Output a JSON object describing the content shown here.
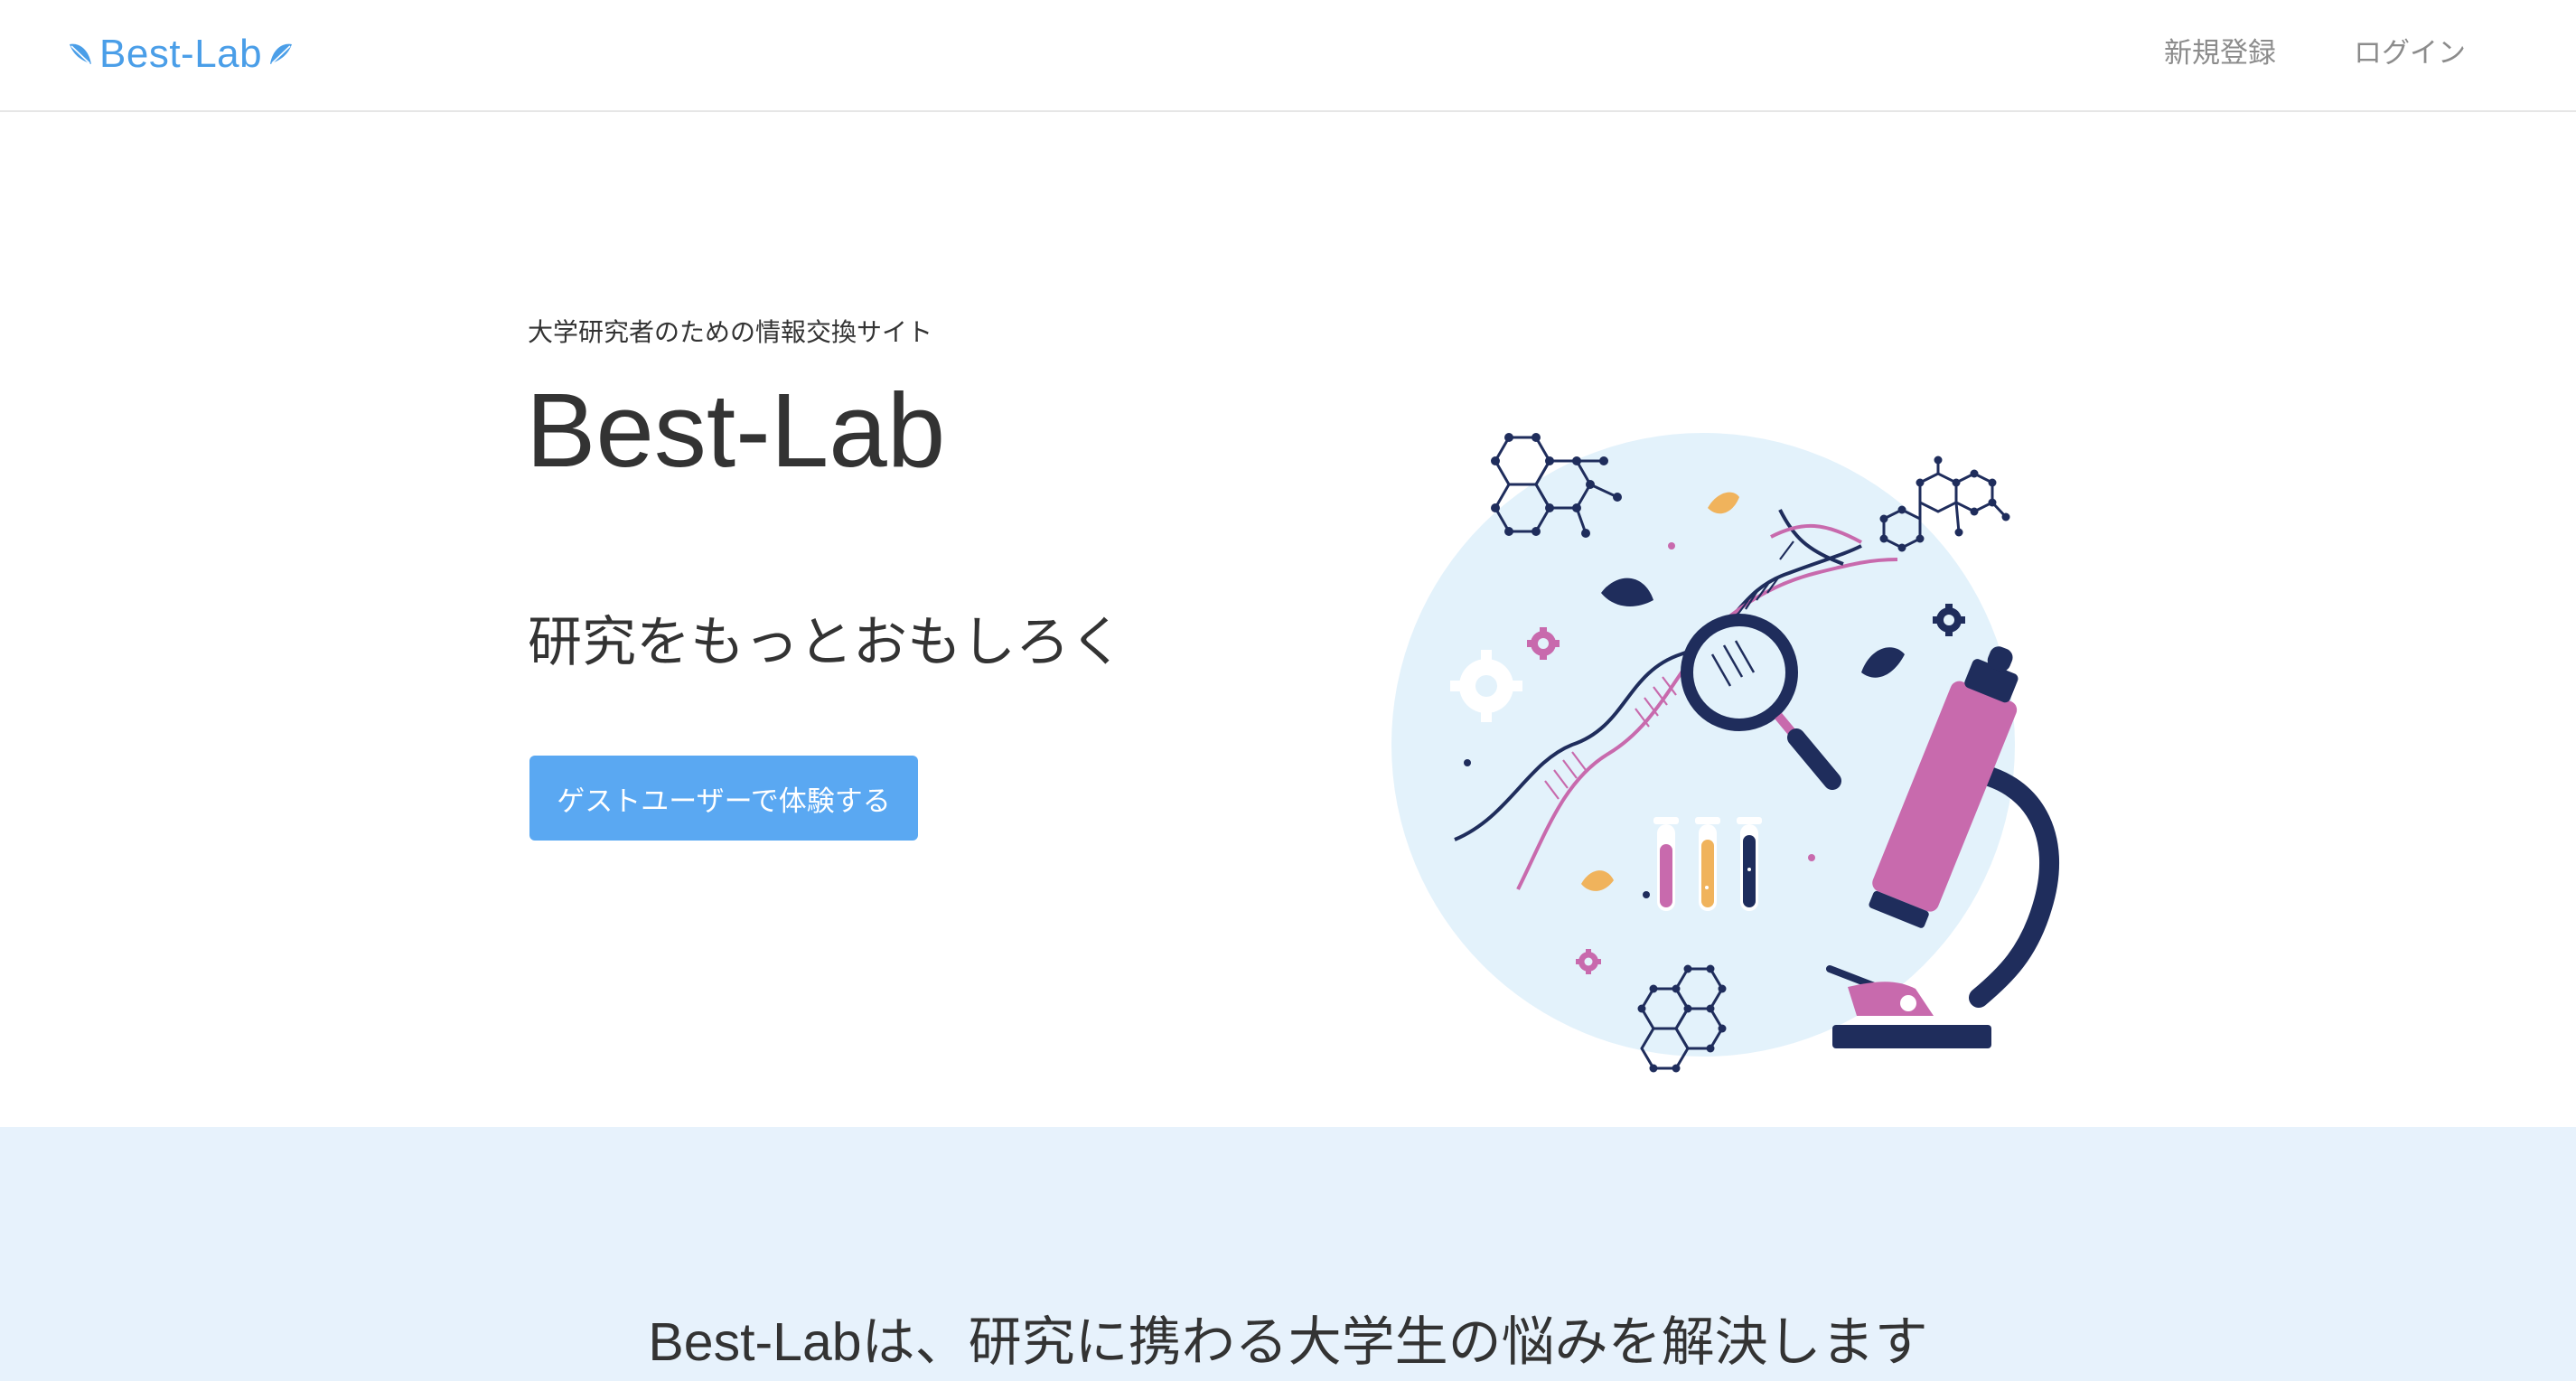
{
  "navbar": {
    "brand": "Best-Lab",
    "links": [
      "新規登録",
      "ログイン"
    ]
  },
  "hero": {
    "subtitle": "大学研究者のための情報交換サイト",
    "title": "Best-Lab",
    "tagline": "研究をもっとおもしろく",
    "guest_button": "ゲストユーザーで体験する",
    "illustration": "science-lab-illustration"
  },
  "about": {
    "heading": "Best-Labは、研究に携わる大学生の悩みを解決します"
  },
  "colors": {
    "brand_blue": "#4a9ee8",
    "button_blue": "#5aa8f2",
    "section_bg": "#e7f2fc",
    "nav_text": "#8c8c8c",
    "illustration_circle": "#e3f2fb",
    "navy": "#1f2d5c",
    "pink": "#c86aad",
    "orange": "#f0b35c"
  }
}
